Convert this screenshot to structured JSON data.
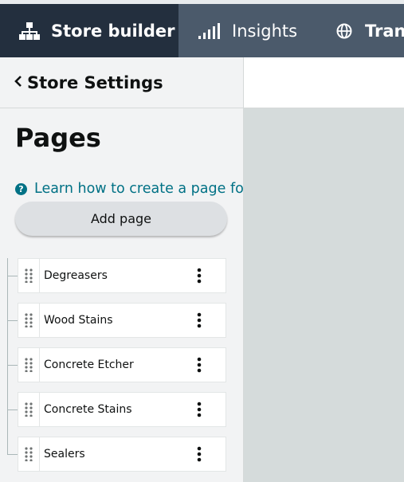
{
  "topnav": {
    "tabs": [
      {
        "label": "Store builder",
        "icon": "sitemap-icon",
        "active": true
      },
      {
        "label": "Insights",
        "icon": "bar-chart-icon",
        "active": false
      },
      {
        "label": "Trans",
        "icon": "globe-icon",
        "active": false
      }
    ]
  },
  "sidebar": {
    "back_label": "Store Settings",
    "heading": "Pages",
    "help_link": "Learn how to create a page fo",
    "add_button": "Add page",
    "pages": [
      {
        "label": "Degreasers"
      },
      {
        "label": "Wood Stains"
      },
      {
        "label": "Concrete Etcher"
      },
      {
        "label": "Concrete Stains"
      },
      {
        "label": "Sealers"
      }
    ]
  },
  "colors": {
    "nav_active": "#232f3e",
    "nav_bg": "#4b5a6b",
    "panel_bg": "#f2f3f4",
    "canvas_bg": "#d5dbdb",
    "link": "#007185"
  }
}
